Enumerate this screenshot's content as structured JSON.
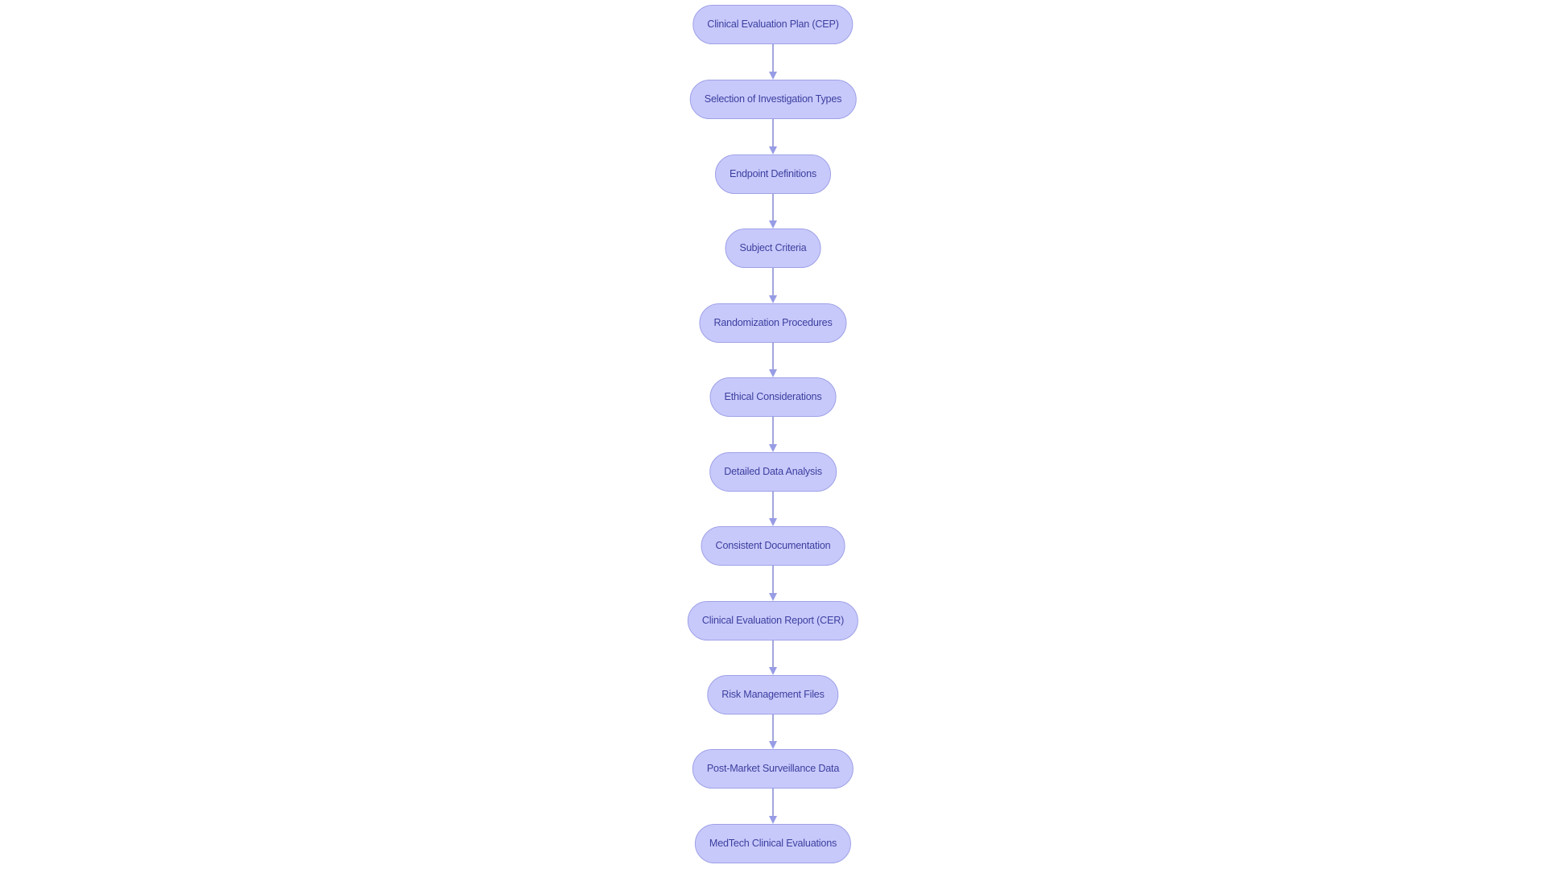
{
  "diagram": {
    "type": "flowchart",
    "direction": "top-to-bottom",
    "colors": {
      "node_fill": "#c8c9fb",
      "node_border": "#9ea1e6",
      "node_text": "#3b3f9e",
      "edge": "#a3a6dc",
      "arrowhead": "#979ce5",
      "background": "#ffffff"
    },
    "nodes": [
      {
        "id": "n1",
        "label": "Clinical Evaluation Plan (CEP)"
      },
      {
        "id": "n2",
        "label": "Selection of Investigation Types"
      },
      {
        "id": "n3",
        "label": "Endpoint Definitions"
      },
      {
        "id": "n4",
        "label": "Subject Criteria"
      },
      {
        "id": "n5",
        "label": "Randomization Procedures"
      },
      {
        "id": "n6",
        "label": "Ethical Considerations"
      },
      {
        "id": "n7",
        "label": "Detailed Data Analysis"
      },
      {
        "id": "n8",
        "label": "Consistent Documentation"
      },
      {
        "id": "n9",
        "label": "Clinical Evaluation Report (CER)"
      },
      {
        "id": "n10",
        "label": "Risk Management Files"
      },
      {
        "id": "n11",
        "label": "Post-Market Surveillance Data"
      },
      {
        "id": "n12",
        "label": "MedTech Clinical Evaluations"
      }
    ],
    "edges": [
      {
        "from": "n1",
        "to": "n2"
      },
      {
        "from": "n2",
        "to": "n3"
      },
      {
        "from": "n3",
        "to": "n4"
      },
      {
        "from": "n4",
        "to": "n5"
      },
      {
        "from": "n5",
        "to": "n6"
      },
      {
        "from": "n6",
        "to": "n7"
      },
      {
        "from": "n7",
        "to": "n8"
      },
      {
        "from": "n8",
        "to": "n9"
      },
      {
        "from": "n9",
        "to": "n10"
      },
      {
        "from": "n10",
        "to": "n11"
      },
      {
        "from": "n11",
        "to": "n12"
      }
    ]
  }
}
